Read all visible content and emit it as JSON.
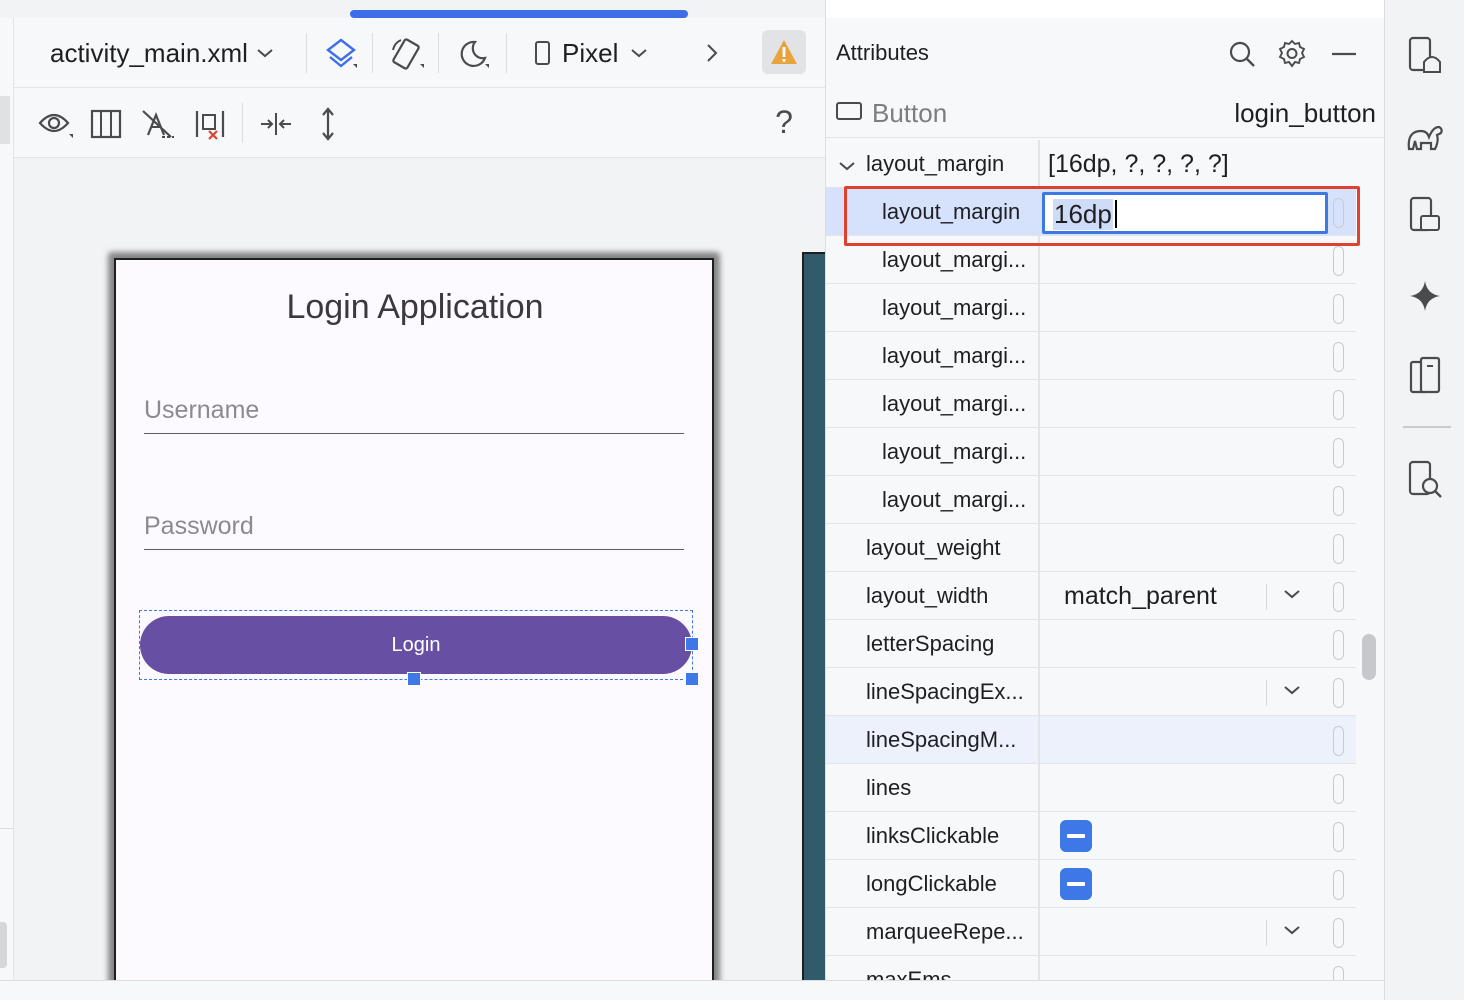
{
  "editor": {
    "file_name": "activity_main.xml",
    "device_name": "Pixel",
    "help_label": "?"
  },
  "phone": {
    "title": "Login Application",
    "username_hint": "Username",
    "password_hint": "Password",
    "login_label": "Login",
    "button_color": "#6750a4"
  },
  "attributes": {
    "title": "Attributes",
    "component_type": "Button",
    "component_id": "login_button",
    "rows": [
      {
        "name": "layout_margin",
        "value": "[16dp, ?, ?, ?, ?]"
      },
      {
        "name": "layout_margin",
        "value": "16dp"
      },
      {
        "name": "layout_margi...",
        "value": ""
      },
      {
        "name": "layout_margi...",
        "value": ""
      },
      {
        "name": "layout_margi...",
        "value": ""
      },
      {
        "name": "layout_margi...",
        "value": ""
      },
      {
        "name": "layout_margi...",
        "value": ""
      },
      {
        "name": "layout_margi...",
        "value": ""
      },
      {
        "name": "layout_weight",
        "value": ""
      },
      {
        "name": "layout_width",
        "value": "match_parent"
      },
      {
        "name": "letterSpacing",
        "value": ""
      },
      {
        "name": "lineSpacingEx...",
        "value": ""
      },
      {
        "name": "lineSpacingM...",
        "value": ""
      },
      {
        "name": "lines",
        "value": ""
      },
      {
        "name": "linksClickable",
        "value": ""
      },
      {
        "name": "longClickable",
        "value": ""
      },
      {
        "name": "marqueeRepe...",
        "value": ""
      },
      {
        "name": "maxEms",
        "value": ""
      }
    ]
  },
  "colors": {
    "accent": "#3d78e6",
    "highlight_border": "#e0412f",
    "warning": "#e8a33d"
  },
  "icons": {
    "file_dropdown": "chevron-down-icon",
    "design_surface": "layers-icon",
    "orientation": "rotate-device-icon",
    "night_mode": "moon-icon",
    "device": "phone-icon",
    "more": "chevron-right-icon",
    "warning": "warning-icon",
    "attr_search": "search-icon",
    "attr_settings": "gear-icon",
    "attr_minimize": "minimize-icon"
  }
}
